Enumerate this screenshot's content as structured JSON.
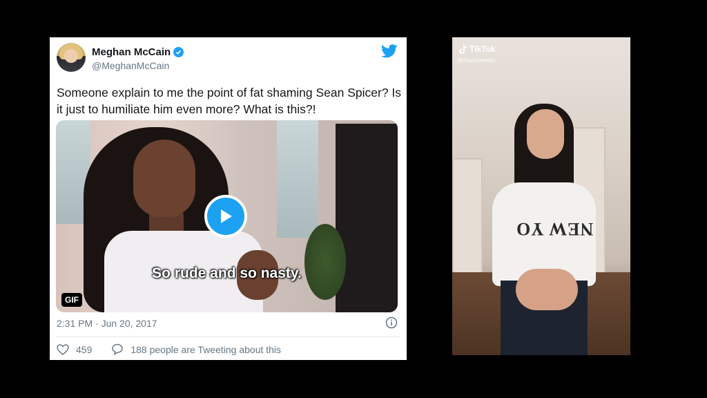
{
  "tweet": {
    "author_name": "Meghan McCain",
    "handle": "@MeghanMcCain",
    "text": "Someone explain to me the point of fat shaming Sean Spicer? Is it just to humiliate him even more? What is this?!",
    "media": {
      "caption": "So rude and so nasty.",
      "badge": "GIF"
    },
    "timestamp": "2:31 PM · Jun 20, 2017",
    "likes": "459",
    "conversation": "188 people are Tweeting about this"
  },
  "tiktok": {
    "logo_text": "TikTok",
    "username": "@charlidamelio",
    "shirt_text": "NEW YO"
  },
  "colors": {
    "twitter_blue": "#1da1f2",
    "text_primary": "#14171a",
    "text_secondary": "#657786"
  }
}
